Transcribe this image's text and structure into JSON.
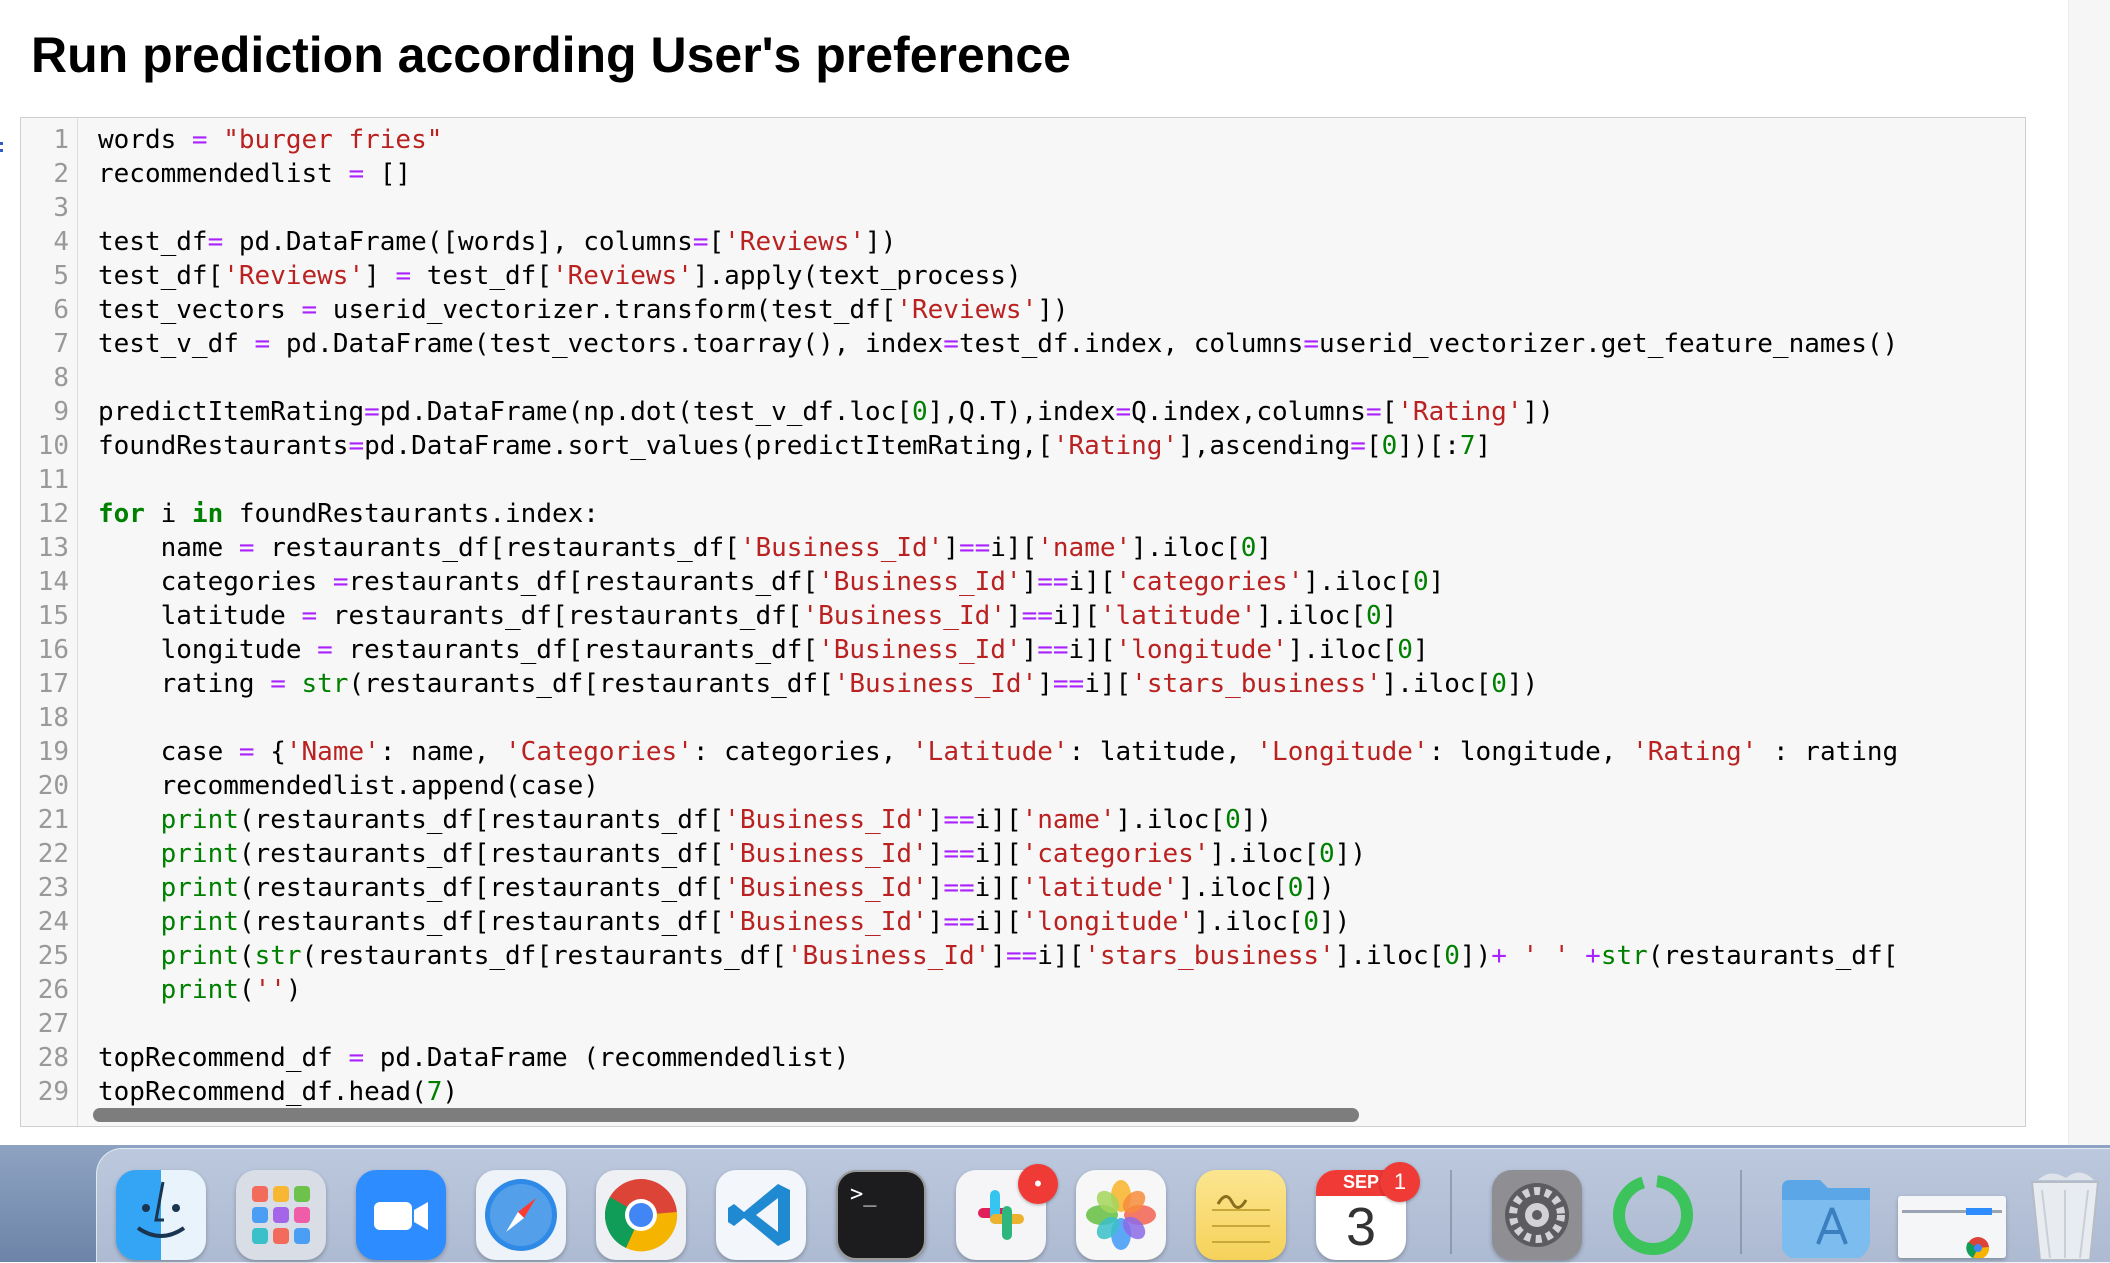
{
  "heading": "Run prediction according User's preference",
  "code_lines": [
    [
      [
        "",
        "words "
      ],
      [
        "o",
        "="
      ],
      [
        "",
        " "
      ],
      [
        "s",
        "\"burger fries\""
      ]
    ],
    [
      [
        "",
        "recommendedlist "
      ],
      [
        "o",
        "="
      ],
      [
        "",
        " []"
      ]
    ],
    [],
    [
      [
        "",
        "test_df"
      ],
      [
        "o",
        "="
      ],
      [
        "",
        " pd.DataFrame([words], columns"
      ],
      [
        "o",
        "="
      ],
      [
        "",
        "["
      ],
      [
        "s",
        "'Reviews'"
      ],
      [
        "",
        "])"
      ]
    ],
    [
      [
        "",
        "test_df["
      ],
      [
        "s",
        "'Reviews'"
      ],
      [
        "",
        "] "
      ],
      [
        "o",
        "="
      ],
      [
        "",
        " test_df["
      ],
      [
        "s",
        "'Reviews'"
      ],
      [
        "",
        "].apply(text_process)"
      ]
    ],
    [
      [
        "",
        "test_vectors "
      ],
      [
        "o",
        "="
      ],
      [
        "",
        " userid_vectorizer.transform(test_df["
      ],
      [
        "s",
        "'Reviews'"
      ],
      [
        "",
        "])"
      ]
    ],
    [
      [
        "",
        "test_v_df "
      ],
      [
        "o",
        "="
      ],
      [
        "",
        " pd.DataFrame(test_vectors.toarray(), index"
      ],
      [
        "o",
        "="
      ],
      [
        "",
        "test_df.index, columns"
      ],
      [
        "o",
        "="
      ],
      [
        "",
        "userid_vectorizer.get_feature_names()"
      ]
    ],
    [],
    [
      [
        "",
        "predictItemRating"
      ],
      [
        "o",
        "="
      ],
      [
        "",
        "pd.DataFrame(np.dot(test_v_df.loc["
      ],
      [
        "n",
        "0"
      ],
      [
        "",
        "],Q.T),index"
      ],
      [
        "o",
        "="
      ],
      [
        "",
        "Q.index,columns"
      ],
      [
        "o",
        "="
      ],
      [
        "",
        "["
      ],
      [
        "s",
        "'Rating'"
      ],
      [
        "",
        "])"
      ]
    ],
    [
      [
        "",
        "foundRestaurants"
      ],
      [
        "o",
        "="
      ],
      [
        "",
        "pd.DataFrame.sort_values(predictItemRating,["
      ],
      [
        "s",
        "'Rating'"
      ],
      [
        "",
        "],ascending"
      ],
      [
        "o",
        "="
      ],
      [
        "",
        "["
      ],
      [
        "n",
        "0"
      ],
      [
        "",
        "])[:"
      ],
      [
        "n",
        "7"
      ],
      [
        "",
        "]"
      ]
    ],
    [],
    [
      [
        "k",
        "for"
      ],
      [
        "",
        " i "
      ],
      [
        "k",
        "in"
      ],
      [
        "",
        " foundRestaurants.index:"
      ]
    ],
    [
      [
        "",
        "    name "
      ],
      [
        "o",
        "="
      ],
      [
        "",
        " restaurants_df[restaurants_df["
      ],
      [
        "s",
        "'Business_Id'"
      ],
      [
        "",
        "]"
      ],
      [
        "o",
        "=="
      ],
      [
        "",
        "i]["
      ],
      [
        "s",
        "'name'"
      ],
      [
        "",
        "].iloc["
      ],
      [
        "n",
        "0"
      ],
      [
        "",
        "]"
      ]
    ],
    [
      [
        "",
        "    categories "
      ],
      [
        "o",
        "="
      ],
      [
        "",
        "restaurants_df[restaurants_df["
      ],
      [
        "s",
        "'Business_Id'"
      ],
      [
        "",
        "]"
      ],
      [
        "o",
        "=="
      ],
      [
        "",
        "i]["
      ],
      [
        "s",
        "'categories'"
      ],
      [
        "",
        "].iloc["
      ],
      [
        "n",
        "0"
      ],
      [
        "",
        "]"
      ]
    ],
    [
      [
        "",
        "    latitude "
      ],
      [
        "o",
        "="
      ],
      [
        "",
        " restaurants_df[restaurants_df["
      ],
      [
        "s",
        "'Business_Id'"
      ],
      [
        "",
        "]"
      ],
      [
        "o",
        "=="
      ],
      [
        "",
        "i]["
      ],
      [
        "s",
        "'latitude'"
      ],
      [
        "",
        "].iloc["
      ],
      [
        "n",
        "0"
      ],
      [
        "",
        "]"
      ]
    ],
    [
      [
        "",
        "    longitude "
      ],
      [
        "o",
        "="
      ],
      [
        "",
        " restaurants_df[restaurants_df["
      ],
      [
        "s",
        "'Business_Id'"
      ],
      [
        "",
        "]"
      ],
      [
        "o",
        "=="
      ],
      [
        "",
        "i]["
      ],
      [
        "s",
        "'longitude'"
      ],
      [
        "",
        "].iloc["
      ],
      [
        "n",
        "0"
      ],
      [
        "",
        "]"
      ]
    ],
    [
      [
        "",
        "    rating "
      ],
      [
        "o",
        "="
      ],
      [
        "",
        " "
      ],
      [
        "b",
        "str"
      ],
      [
        "",
        "(restaurants_df[restaurants_df["
      ],
      [
        "s",
        "'Business_Id'"
      ],
      [
        "",
        "]"
      ],
      [
        "o",
        "=="
      ],
      [
        "",
        "i]["
      ],
      [
        "s",
        "'stars_business'"
      ],
      [
        "",
        "].iloc["
      ],
      [
        "n",
        "0"
      ],
      [
        "",
        "])"
      ]
    ],
    [],
    [
      [
        "",
        "    case "
      ],
      [
        "o",
        "="
      ],
      [
        "",
        " {"
      ],
      [
        "s",
        "'Name'"
      ],
      [
        "",
        ": name, "
      ],
      [
        "s",
        "'Categories'"
      ],
      [
        "",
        ": categories, "
      ],
      [
        "s",
        "'Latitude'"
      ],
      [
        "",
        ": latitude, "
      ],
      [
        "s",
        "'Longitude'"
      ],
      [
        "",
        ": longitude, "
      ],
      [
        "s",
        "'Rating'"
      ],
      [
        "",
        " : rating"
      ]
    ],
    [
      [
        "",
        "    recommendedlist.append(case)"
      ]
    ],
    [
      [
        "",
        "    "
      ],
      [
        "b",
        "print"
      ],
      [
        "",
        "(restaurants_df[restaurants_df["
      ],
      [
        "s",
        "'Business_Id'"
      ],
      [
        "",
        "]"
      ],
      [
        "o",
        "=="
      ],
      [
        "",
        "i]["
      ],
      [
        "s",
        "'name'"
      ],
      [
        "",
        "].iloc["
      ],
      [
        "n",
        "0"
      ],
      [
        "",
        "])"
      ]
    ],
    [
      [
        "",
        "    "
      ],
      [
        "b",
        "print"
      ],
      [
        "",
        "(restaurants_df[restaurants_df["
      ],
      [
        "s",
        "'Business_Id'"
      ],
      [
        "",
        "]"
      ],
      [
        "o",
        "=="
      ],
      [
        "",
        "i]["
      ],
      [
        "s",
        "'categories'"
      ],
      [
        "",
        "].iloc["
      ],
      [
        "n",
        "0"
      ],
      [
        "",
        "])"
      ]
    ],
    [
      [
        "",
        "    "
      ],
      [
        "b",
        "print"
      ],
      [
        "",
        "(restaurants_df[restaurants_df["
      ],
      [
        "s",
        "'Business_Id'"
      ],
      [
        "",
        "]"
      ],
      [
        "o",
        "=="
      ],
      [
        "",
        "i]["
      ],
      [
        "s",
        "'latitude'"
      ],
      [
        "",
        "].iloc["
      ],
      [
        "n",
        "0"
      ],
      [
        "",
        "])"
      ]
    ],
    [
      [
        "",
        "    "
      ],
      [
        "b",
        "print"
      ],
      [
        "",
        "(restaurants_df[restaurants_df["
      ],
      [
        "s",
        "'Business_Id'"
      ],
      [
        "",
        "]"
      ],
      [
        "o",
        "=="
      ],
      [
        "",
        "i]["
      ],
      [
        "s",
        "'longitude'"
      ],
      [
        "",
        "].iloc["
      ],
      [
        "n",
        "0"
      ],
      [
        "",
        "])"
      ]
    ],
    [
      [
        "",
        "    "
      ],
      [
        "b",
        "print"
      ],
      [
        "",
        "("
      ],
      [
        "b",
        "str"
      ],
      [
        "",
        "(restaurants_df[restaurants_df["
      ],
      [
        "s",
        "'Business_Id'"
      ],
      [
        "",
        "]"
      ],
      [
        "o",
        "=="
      ],
      [
        "",
        "i]["
      ],
      [
        "s",
        "'stars_business'"
      ],
      [
        "",
        "].iloc["
      ],
      [
        "n",
        "0"
      ],
      [
        "",
        "])"
      ],
      [
        "o",
        "+"
      ],
      [
        "",
        " "
      ],
      [
        "s",
        "' '"
      ],
      [
        "",
        " "
      ],
      [
        "o",
        "+"
      ],
      [
        "b",
        "str"
      ],
      [
        "",
        "(restaurants_df["
      ]
    ],
    [
      [
        "",
        "    "
      ],
      [
        "b",
        "print"
      ],
      [
        "",
        "("
      ],
      [
        "s",
        "''"
      ],
      [
        "",
        ")"
      ]
    ],
    [],
    [
      [
        "",
        "topRecommend_df "
      ],
      [
        "o",
        "="
      ],
      [
        "",
        " pd.DataFrame (recommendedlist)"
      ]
    ],
    [
      [
        "",
        "topRecommend_df.head("
      ],
      [
        "n",
        "7"
      ],
      [
        "",
        ")"
      ]
    ]
  ],
  "dock": {
    "apps": [
      {
        "name": "finder-app-icon",
        "label": "Finder"
      },
      {
        "name": "launchpad-app-icon",
        "label": "Launchpad"
      },
      {
        "name": "zoom-app-icon",
        "label": "Zoom"
      },
      {
        "name": "safari-app-icon",
        "label": "Safari"
      },
      {
        "name": "chrome-app-icon",
        "label": "Google Chrome"
      },
      {
        "name": "vscode-app-icon",
        "label": "Visual Studio Code"
      },
      {
        "name": "terminal-app-icon",
        "label": "Terminal",
        "glyph": ">_"
      },
      {
        "name": "slack-app-icon",
        "label": "Slack"
      },
      {
        "name": "photos-app-icon",
        "label": "Photos"
      },
      {
        "name": "notes-app-icon",
        "label": "Notes"
      },
      {
        "name": "calendar-app-icon",
        "label": "Calendar",
        "month": "SEP",
        "day": "3"
      },
      {
        "name": "system-preferences-app-icon",
        "label": "System Preferences"
      },
      {
        "name": "progress-ring-app-icon",
        "label": "Loading app"
      },
      {
        "name": "applications-folder-icon",
        "label": "Applications"
      },
      {
        "name": "chrome-window-thumbnail",
        "label": "Chrome window"
      },
      {
        "name": "trash-icon",
        "label": "Trash"
      }
    ],
    "slack_badge": "•",
    "calendar_badge": "1"
  },
  "colors": {
    "keyword": "#008000",
    "string": "#ba2121",
    "number": "#008000",
    "operator": "#aa22ff",
    "badge": "#f03a36"
  }
}
